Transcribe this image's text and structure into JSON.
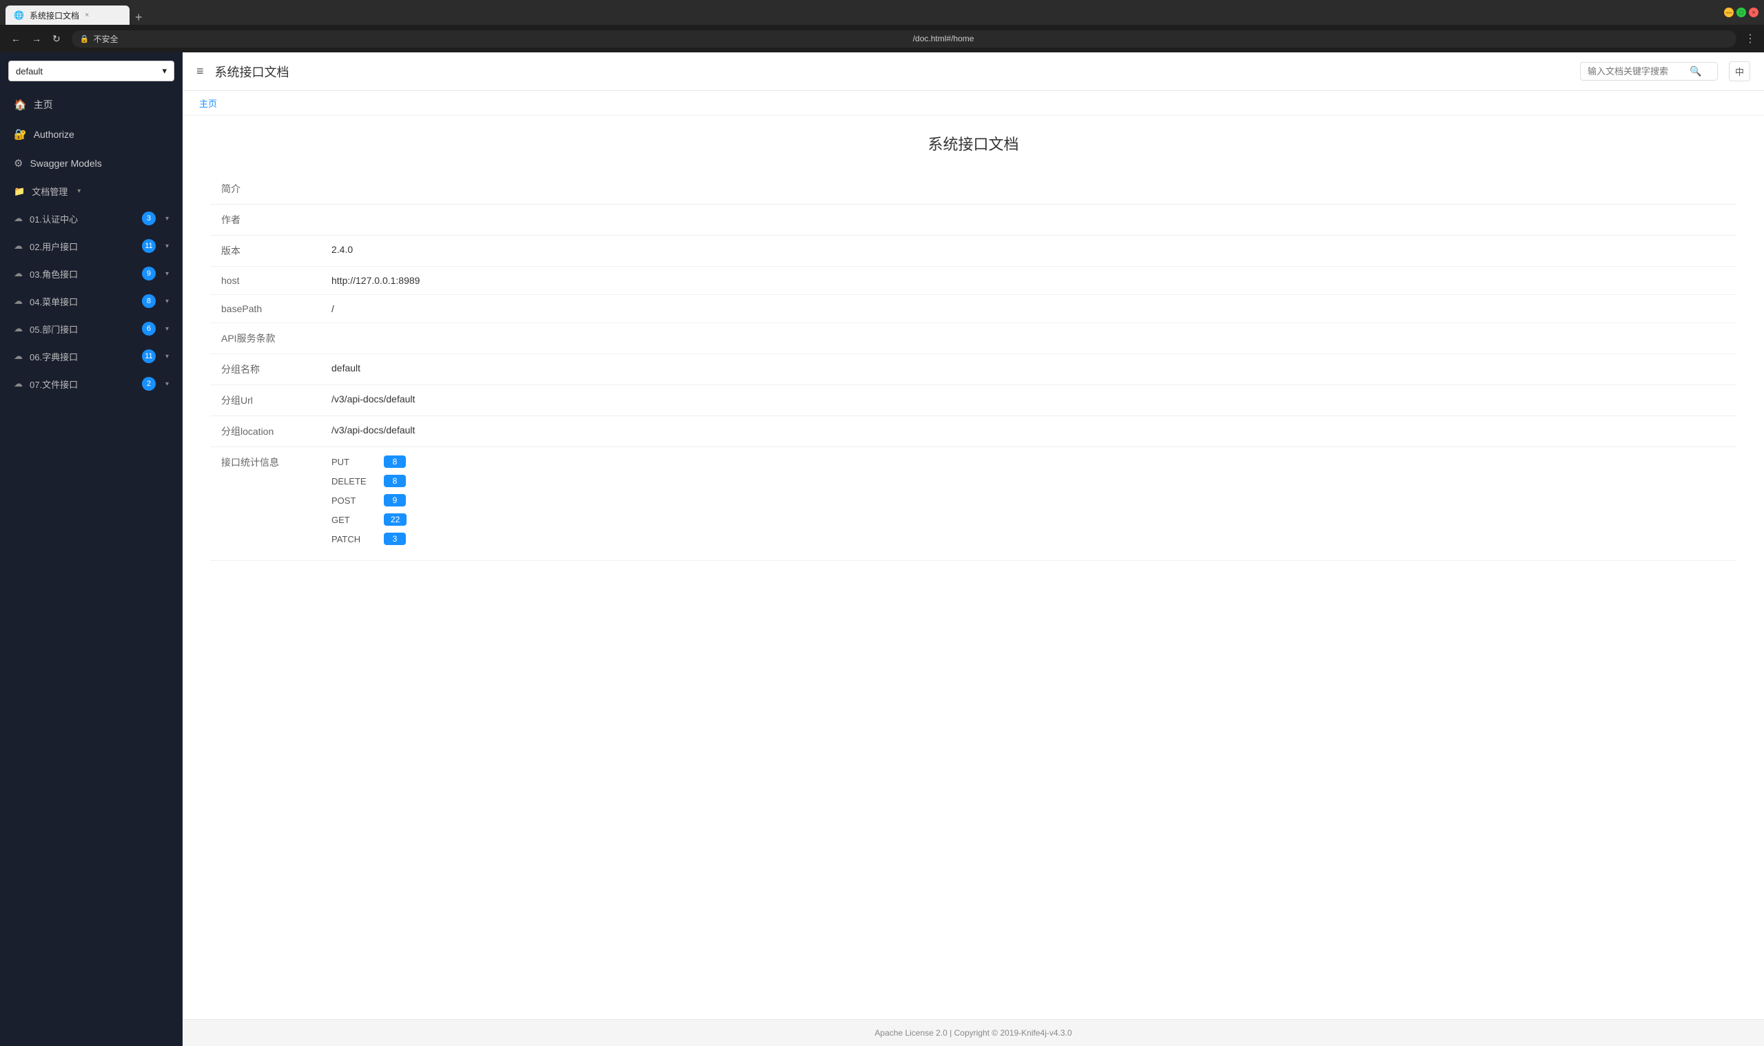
{
  "browser": {
    "tab_title": "系统接口文档",
    "tab_close": "×",
    "tab_new": "+",
    "address_insecure": "不安全",
    "address_url": "/doc.html#/home",
    "nav_back": "←",
    "nav_forward": "→",
    "nav_reload": "↻"
  },
  "header": {
    "hamburger": "≡",
    "title": "系统接口文档",
    "search_placeholder": "输入文档关键字搜索",
    "lang_btn": "中"
  },
  "breadcrumb": {
    "home": "主页"
  },
  "sidebar": {
    "select_value": "default",
    "select_arrow": "▾",
    "nav_home": "主页",
    "nav_authorize": "Authorize",
    "nav_swagger": "Swagger Models",
    "nav_docs_label": "文档管理",
    "groups": [
      {
        "id": "g1",
        "label": "01.认证中心",
        "badge": "3"
      },
      {
        "id": "g2",
        "label": "02.用户接口",
        "badge": "11"
      },
      {
        "id": "g3",
        "label": "03.角色接口",
        "badge": "9"
      },
      {
        "id": "g4",
        "label": "04.菜单接口",
        "badge": "8"
      },
      {
        "id": "g5",
        "label": "05.部门接口",
        "badge": "6"
      },
      {
        "id": "g6",
        "label": "06.字典接口",
        "badge": "11"
      },
      {
        "id": "g7",
        "label": "07.文件接口",
        "badge": "2"
      }
    ]
  },
  "main": {
    "page_title": "系统接口文档",
    "fields": [
      {
        "label": "简介",
        "value": ""
      },
      {
        "label": "作者",
        "value": ""
      },
      {
        "label": "版本",
        "value": "2.4.0"
      },
      {
        "label": "host",
        "value": "http://127.0.0.1:8989"
      },
      {
        "label": "basePath",
        "value": "/"
      },
      {
        "label": "API服务条款",
        "value": ""
      },
      {
        "label": "分组名称",
        "value": "default"
      },
      {
        "label": "分组Url",
        "value": "/v3/api-docs/default"
      },
      {
        "label": "分组location",
        "value": "/v3/api-docs/default"
      }
    ],
    "stats_label": "接口统计信息",
    "stats": [
      {
        "method": "PUT",
        "count": "8"
      },
      {
        "method": "DELETE",
        "count": "8"
      },
      {
        "method": "POST",
        "count": "9"
      },
      {
        "method": "GET",
        "count": "22"
      },
      {
        "method": "PATCH",
        "count": "3"
      }
    ]
  },
  "footer": {
    "text": "Apache License 2.0 | Copyright © 2019-Knife4j-v4.3.0"
  }
}
